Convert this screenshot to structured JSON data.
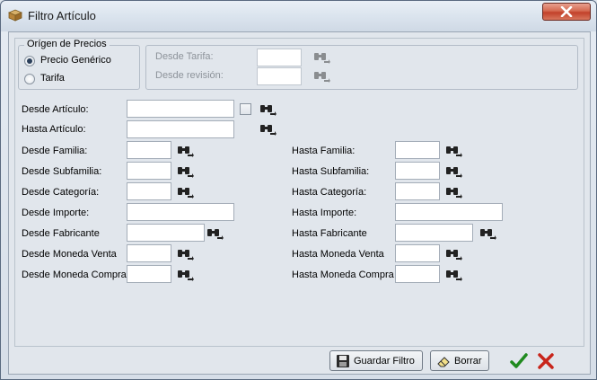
{
  "window": {
    "title": "Filtro Artículo"
  },
  "price_origin": {
    "title": "Orígen de Precios",
    "options": [
      {
        "label": "Precio Genérico",
        "selected": true
      },
      {
        "label": "Tarifa",
        "selected": false
      }
    ]
  },
  "tariff": {
    "desde_tarifa_label": "Desde Tarifa:",
    "desde_revision_label": "Desde revisión:"
  },
  "fields": {
    "desde_articulo": "Desde Artículo:",
    "hasta_articulo": "Hasta Artículo:",
    "desde_familia": "Desde Familia:",
    "hasta_familia": "Hasta Familia:",
    "desde_subfamilia": "Desde Subfamilia:",
    "hasta_subfamilia": "Hasta Subfamilia:",
    "desde_categoria": "Desde Categoría:",
    "hasta_categoria": "Hasta Categoría:",
    "desde_importe": "Desde Importe:",
    "hasta_importe": "Hasta Importe:",
    "desde_fabricante": "Desde Fabricante",
    "hasta_fabricante": "Hasta Fabricante",
    "desde_moneda_venta": "Desde Moneda Venta",
    "hasta_moneda_venta": "Hasta Moneda Venta",
    "desde_moneda_compra": "Desde Moneda Compra",
    "hasta_moneda_compra": "Hasta Moneda Compra"
  },
  "buttons": {
    "guardar_filtro": "Guardar Filtro",
    "borrar": "Borrar"
  },
  "icons": {
    "find": "binoculars-icon",
    "accept": "checkmark-icon",
    "cancel": "red-x-icon"
  },
  "colors": {
    "accept": "#1f8a1f",
    "cancel": "#c8251b",
    "close_button": "#c2412a"
  }
}
